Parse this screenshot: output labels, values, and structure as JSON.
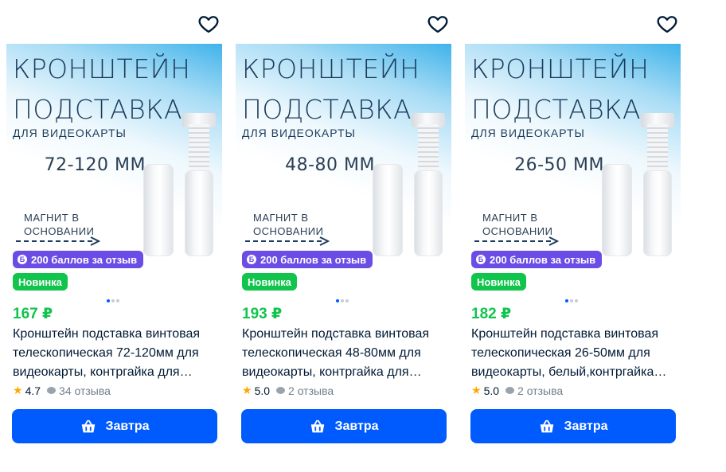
{
  "products": [
    {
      "image": {
        "headline_1": "КРОНШТЕЙН",
        "headline_2": "ПОДСТАВКА",
        "subline": "ДЛЯ ВИДЕОКАРТЫ",
        "size": "72-120 ММ",
        "magnet_1": "МАГНИТ В",
        "magnet_2": "ОСНОВАНИИ"
      },
      "points_badge": "200 баллов за отзыв",
      "points_icon": "Б",
      "new_badge": "Новинка",
      "price": "167 ₽",
      "title": "Кронштейн подставка винтовая телескопическая 72-120мм для видеокарты, контргайка для…",
      "rating": "4.7",
      "reviews": "34 отзыва",
      "cart_label": "Завтра"
    },
    {
      "image": {
        "headline_1": "КРОНШТЕЙН",
        "headline_2": "ПОДСТАВКА",
        "subline": "ДЛЯ ВИДЕОКАРТЫ",
        "size": "48-80 ММ",
        "magnet_1": "МАГНИТ В",
        "magnet_2": "ОСНОВАНИИ"
      },
      "points_badge": "200 баллов за отзыв",
      "points_icon": "Б",
      "new_badge": "Новинка",
      "price": "193 ₽",
      "title": "Кронштейн подставка винтовая телескопическая 48-80мм для видеокарты, контргайка для…",
      "rating": "5.0",
      "reviews": "2 отзыва",
      "cart_label": "Завтра"
    },
    {
      "image": {
        "headline_1": "КРОНШТЕЙН",
        "headline_2": "ПОДСТАВКА",
        "subline": "ДЛЯ ВИДЕОКАРТЫ",
        "size": "26-50 ММ",
        "magnet_1": "МАГНИТ В",
        "magnet_2": "ОСНОВАНИИ"
      },
      "points_badge": "200 баллов за отзыв",
      "points_icon": "Б",
      "new_badge": "Новинка",
      "price": "182 ₽",
      "title": "Кронштейн подставка винтовая телескопическая 26-50мм для видеокарты, белый,контргайка…",
      "rating": "5.0",
      "reviews": "2 отзыва",
      "cart_label": "Завтра"
    }
  ],
  "colors": {
    "accent": "#005bff",
    "price": "#10c44c",
    "points": "#6b4de6",
    "star": "#ffa800"
  },
  "icons": {
    "favorite": "heart-outline-icon",
    "cart": "basket-icon",
    "rating": "star-icon",
    "reviews": "comment-icon"
  }
}
